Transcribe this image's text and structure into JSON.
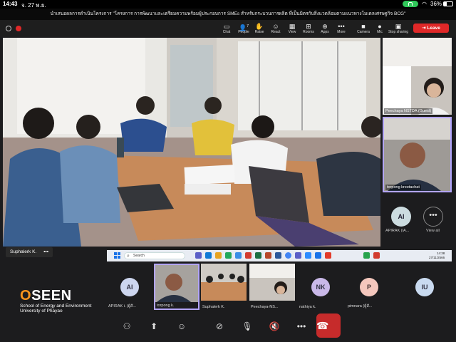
{
  "status_bar": {
    "time": "14:43",
    "date": "จ. 27 พ.ย.",
    "battery": "36%"
  },
  "meeting_title": "นำเสนอผลการดำเนินโครงการ \"โครงการ การพัฒนาและเตรียมความพร้อมผู้ประกอบการ SMEs สำหรับกระบวนการผลิต ที่เป็นมิตรกับสิ่งแวดล้อมตามแนวทางโมเดลเศรษฐกิจ BCG\"",
  "toolbar": {
    "items": [
      {
        "label": "Chat",
        "icon": "chat-icon"
      },
      {
        "label": "People",
        "icon": "people-icon",
        "count": "7"
      },
      {
        "label": "Raise",
        "icon": "raise-hand-icon"
      },
      {
        "label": "React",
        "icon": "react-icon"
      },
      {
        "label": "View",
        "icon": "view-icon"
      },
      {
        "label": "Rooms",
        "icon": "rooms-icon"
      },
      {
        "label": "Apps",
        "icon": "apps-icon"
      },
      {
        "label": "More",
        "icon": "more-icon"
      },
      {
        "label": "Camera",
        "icon": "camera-icon"
      },
      {
        "label": "Mic",
        "icon": "mic-icon"
      },
      {
        "label": "Stop sharing",
        "icon": "share-icon"
      }
    ],
    "leave_label": "Leave"
  },
  "main_video": {
    "speaker_name": "Suphalerk K.",
    "menu": "•••"
  },
  "side_panel": {
    "tiles": [
      {
        "name": "Peechaya NSTDA (Guest)"
      },
      {
        "name": "torpong kreetachat"
      }
    ],
    "avatar": {
      "initials": "AI",
      "name": "APIRAK (IA..."
    },
    "view_all": {
      "symbol": "•••",
      "label": "View all"
    }
  },
  "taskbar": {
    "search_placeholder": "Search",
    "clock_time": "14:38",
    "clock_date": "27/11/2566"
  },
  "gallery": [
    {
      "type": "avatar",
      "initials": "AI",
      "name": "APIRAK i. (ผู้สั...",
      "color": "#cdd6ef",
      "text_color": "#334"
    },
    {
      "type": "video",
      "name": "torpong k."
    },
    {
      "type": "video",
      "name": "Suphalerk K."
    },
    {
      "type": "video",
      "name": "Peechaya-NS..."
    },
    {
      "type": "avatar",
      "initials": "NK",
      "name": "nathiya k.",
      "color": "#c9b8e8",
      "text_color": "#334"
    },
    {
      "type": "avatar",
      "initials": "P",
      "name": "pimnara (ผู้สั...",
      "color": "#f4c7bd",
      "text_color": "#433"
    },
    {
      "type": "avatar",
      "initials": "IU",
      "name": "",
      "color": "#c9daf0",
      "text_color": "#334"
    }
  ],
  "logo": {
    "word_o": "O",
    "word_rest": "SEEN",
    "line1": "School of Energy and Environment",
    "line2": "University of Phayao"
  },
  "controls": [
    {
      "icon": "participants-icon"
    },
    {
      "icon": "share-screen-icon"
    },
    {
      "icon": "reactions-icon"
    },
    {
      "icon": "video-off-icon"
    },
    {
      "icon": "mic-off-icon"
    },
    {
      "icon": "speaker-off-icon"
    },
    {
      "icon": "more-icon"
    },
    {
      "icon": "end-call-icon"
    }
  ],
  "colors": {
    "leave": "#e02828",
    "active_border": "#b3a5ff",
    "brand_orange": "#f7941d"
  }
}
